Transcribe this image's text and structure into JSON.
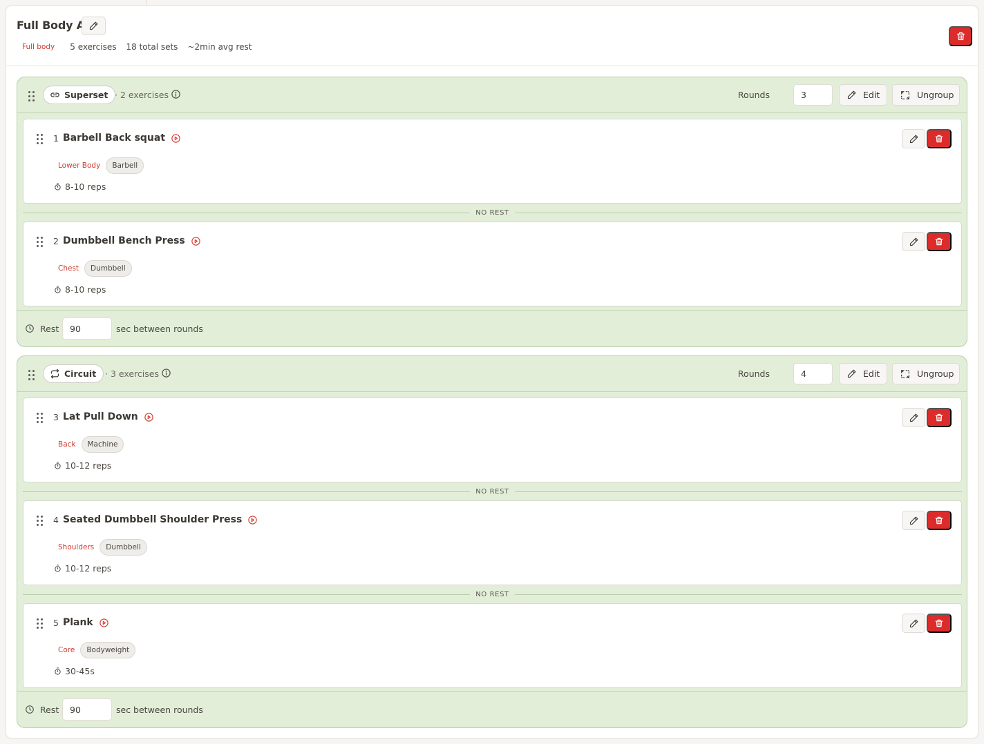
{
  "workout": {
    "title": "Full Body A",
    "tag": "Full body",
    "exercise_count": "5 exercises",
    "total_sets": "18 total sets",
    "avg_rest": "~2min avg rest"
  },
  "colors": {
    "accent": "#dc2b2b",
    "group_bg": "#e3eed9",
    "group_border": "#b7cfa8"
  },
  "groups": [
    {
      "type_label": "Superset",
      "count_label": "· 2 exercises",
      "rounds_label": "Rounds",
      "rounds_value": "3",
      "edit_label": "Edit",
      "ungroup_label": "Ungroup",
      "rest_label": "Rest",
      "rest_value": "90",
      "rest_suffix": "sec between rounds",
      "exercises": [
        {
          "num": "1",
          "name": "Barbell Back squat",
          "muscle": "Lower Body",
          "equipment": "Barbell",
          "reps": "8-10 reps"
        },
        {
          "num": "2",
          "name": "Dumbbell Bench Press",
          "muscle": "Chest",
          "equipment": "Dumbbell",
          "reps": "8-10 reps"
        }
      ],
      "separators": [
        "NO REST"
      ]
    },
    {
      "type_label": "Circuit",
      "count_label": "· 3 exercises",
      "rounds_label": "Rounds",
      "rounds_value": "4",
      "edit_label": "Edit",
      "ungroup_label": "Ungroup",
      "rest_label": "Rest",
      "rest_value": "90",
      "rest_suffix": "sec between rounds",
      "exercises": [
        {
          "num": "3",
          "name": "Lat Pull Down",
          "muscle": "Back",
          "equipment": "Machine",
          "reps": "10-12 reps"
        },
        {
          "num": "4",
          "name": "Seated Dumbbell Shoulder Press",
          "muscle": "Shoulders",
          "equipment": "Dumbbell",
          "reps": "10-12 reps"
        },
        {
          "num": "5",
          "name": "Plank",
          "muscle": "Core",
          "equipment": "Bodyweight",
          "reps": "30-45s"
        }
      ],
      "separators": [
        "NO REST",
        "NO REST"
      ]
    }
  ]
}
